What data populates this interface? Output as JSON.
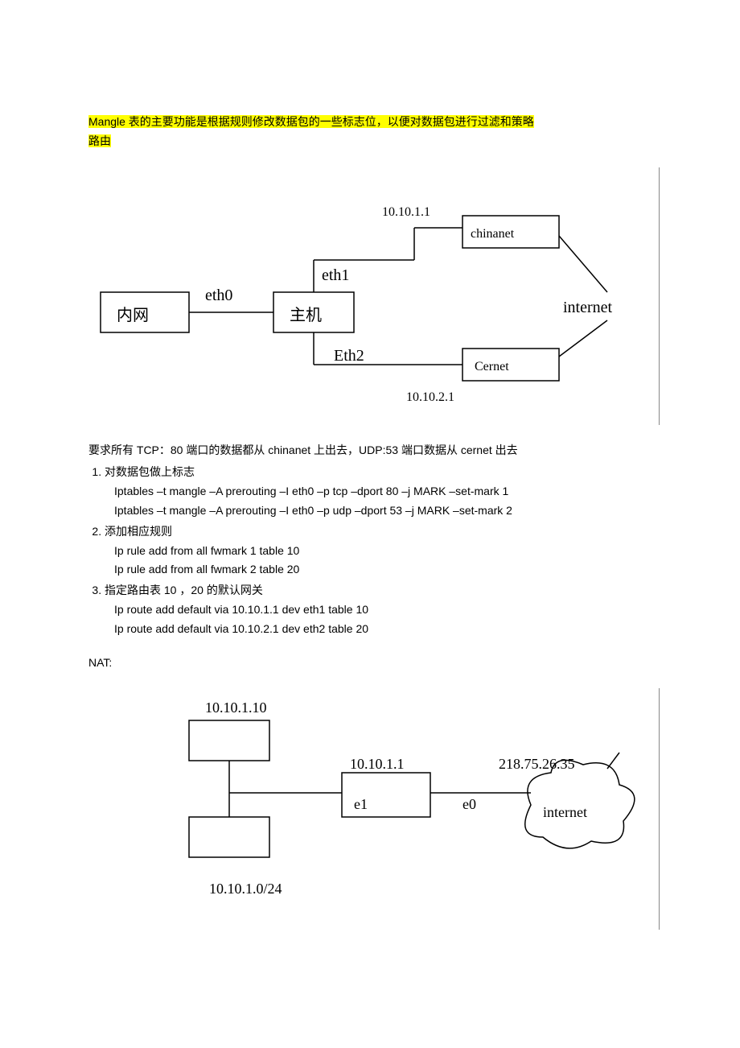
{
  "intro_highlight_line1": "Mangle 表的主要功能是根据规则修改数据包的一些标志位，以便对数据包进行过滤和策略",
  "intro_highlight_line2": "路由",
  "diagram1": {
    "lan": "内网",
    "eth0": "eth0",
    "eth1": "eth1",
    "eth2": "Eth2",
    "host": "主机",
    "ip1": "10.10.1.1",
    "ip2": "10.10.2.1",
    "chinanet": "chinanet",
    "cernet": "Cernet",
    "internet": "internet"
  },
  "requirement": "要求所有 TCP：80 端口的数据都从 chinanet 上出去，UDP:53 端口数据从 cernet 出去",
  "steps": {
    "s1": {
      "title": "对数据包做上标志",
      "cmd1": "Iptables –t mangle –A prerouting –I eth0 –p tcp –dport 80 –j MARK –set-mark 1",
      "cmd2": "Iptables –t mangle –A prerouting –I eth0 –p udp –dport 53 –j MARK –set-mark 2"
    },
    "s2": {
      "title": "添加相应规则",
      "cmd1": "Ip rule add from all fwmark 1 table 10",
      "cmd2": "Ip rule add from all fwmark 2 table 20"
    },
    "s3": {
      "title": "指定路由表 10 ，20 的默认网关",
      "cmd1": "Ip route add default via 10.10.1.1 dev eth1 table 10",
      "cmd2": "Ip route add default via 10.10.2.1 dev eth2 table 20"
    }
  },
  "nat_label": "NAT:",
  "diagram2": {
    "ip_top": "10.10.1.10",
    "ip_mid": "10.10.1.1",
    "e1": "e1",
    "e0": "e0",
    "ext_ip": "218.75.26.35",
    "internet": "internet",
    "subnet": "10.10.1.0/24"
  }
}
